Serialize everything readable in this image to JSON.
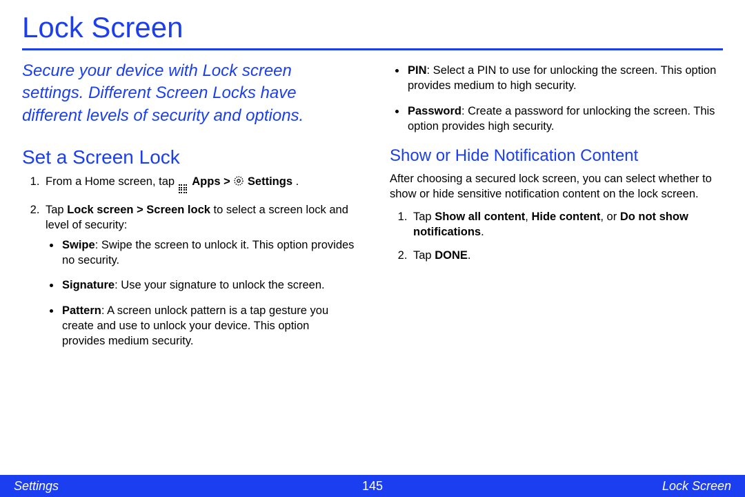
{
  "title": "Lock Screen",
  "intro": "Secure your device with Lock screen settings. Different Screen Locks have different levels of security and options.",
  "section1": {
    "heading": "Set a Screen Lock",
    "step1_pre": "From a Home screen, tap ",
    "step1_apps": "Apps",
    "step1_gt": " > ",
    "step1_settings": "Settings",
    "step1_post": ".",
    "step2_pre": "Tap ",
    "step2_bold": "Lock screen > Screen lock",
    "step2_post": " to select a screen lock and level of security:",
    "bullets": {
      "swipe_b": "Swipe",
      "swipe_t": ": Swipe the screen to unlock it. This option provides no security.",
      "sig_b": "Signature",
      "sig_t": ": Use your signature to unlock the screen.",
      "pat_b": "Pattern",
      "pat_t": ": A screen unlock pattern is a tap gesture you create and use to unlock your device. This option provides medium security.",
      "pin_b": "PIN",
      "pin_t": ": Select a PIN to use for unlocking the screen. This option provides medium to high security.",
      "pwd_b": "Password",
      "pwd_t": ": Create a password for unlocking the screen. This option provides high security."
    }
  },
  "section2": {
    "heading": "Show or Hide Notification Content",
    "intro": "After choosing a secured lock screen, you can select whether to show or hide sensitive notification content on the lock screen.",
    "step1_pre": "Tap ",
    "step1_b1": "Show all content",
    "step1_c1": ", ",
    "step1_b2": "Hide content",
    "step1_c2": ", or ",
    "step1_b3": "Do not show notifications",
    "step1_post": ".",
    "step2_pre": "Tap ",
    "step2_b": "DONE",
    "step2_post": "."
  },
  "footer": {
    "left": "Settings",
    "page": "145",
    "right": "Lock Screen"
  }
}
